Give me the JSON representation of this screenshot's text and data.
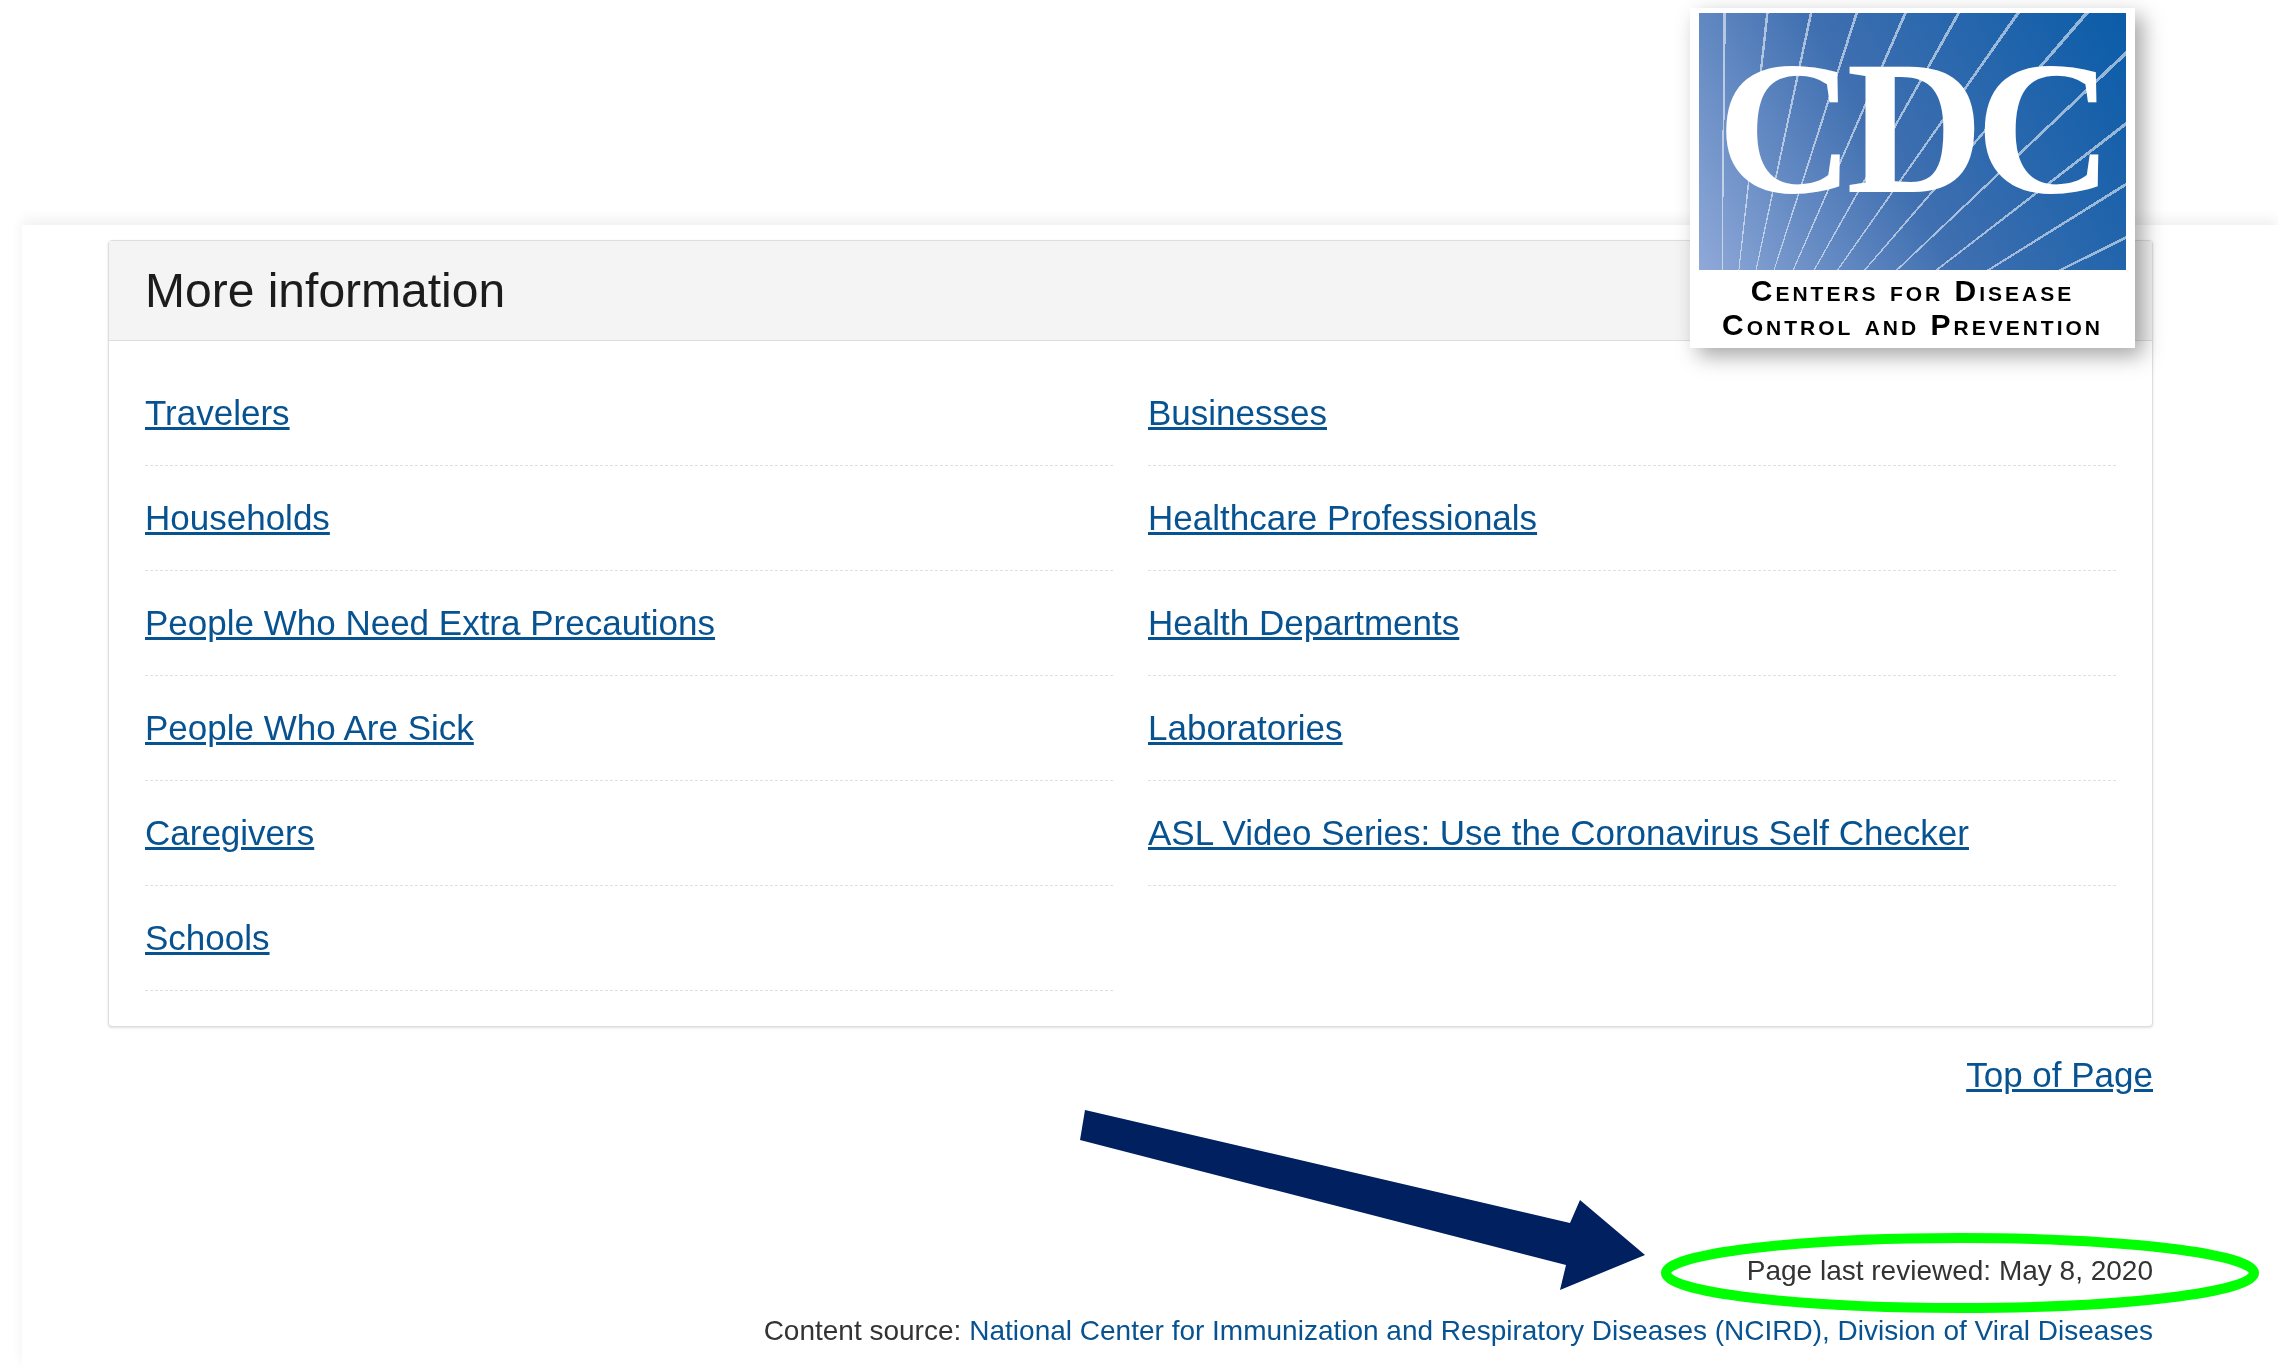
{
  "logo": {
    "letters": "CDC",
    "line_1": "Centers for Disease",
    "line_2": "Control and Prevention"
  },
  "panel": {
    "title": "More information",
    "columns": [
      [
        {
          "label": "Travelers"
        },
        {
          "label": "Households"
        },
        {
          "label": "People Who Need Extra Precautions"
        },
        {
          "label": "People Who Are Sick"
        },
        {
          "label": "Caregivers"
        },
        {
          "label": "Schools"
        }
      ],
      [
        {
          "label": "Businesses"
        },
        {
          "label": "Healthcare Professionals"
        },
        {
          "label": "Health Departments"
        },
        {
          "label": "Laboratories"
        },
        {
          "label": "ASL Video Series: Use the Coronavirus Self Checker"
        }
      ]
    ]
  },
  "top_link": "Top of Page",
  "footer": {
    "last_reviewed": "Page last reviewed: May 8, 2020",
    "source_label": "Content source:",
    "source_link": "National Center for Immunization and Respiratory Diseases (NCIRD), Division of Viral Diseases"
  }
}
